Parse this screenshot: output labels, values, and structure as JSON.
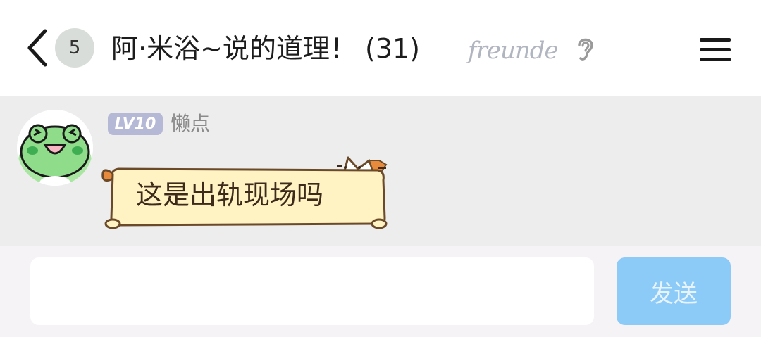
{
  "header": {
    "back_icon": "chevron-left-icon",
    "unread_count": "5",
    "title": "阿·米浴~说的道理！ (31)",
    "title_decoration": "freunde",
    "ear_icon": "ear-icon",
    "menu_icon": "hamburger-menu-icon"
  },
  "messages": [
    {
      "sender": {
        "level": "LV10",
        "name": "懒点",
        "avatar": "green-frog-avatar"
      },
      "text": "这是出轨现场吗",
      "bubble_style": "cat-sticker-bubble"
    }
  ],
  "composer": {
    "input_value": "",
    "input_placeholder": "",
    "send_label": "发送"
  },
  "colors": {
    "send_button": "#8ccaf7",
    "chat_background": "#ededed",
    "level_tag": "#b5b9d6",
    "bubble_fill": "#fff3c4",
    "bubble_stroke": "#6b4a2a"
  }
}
